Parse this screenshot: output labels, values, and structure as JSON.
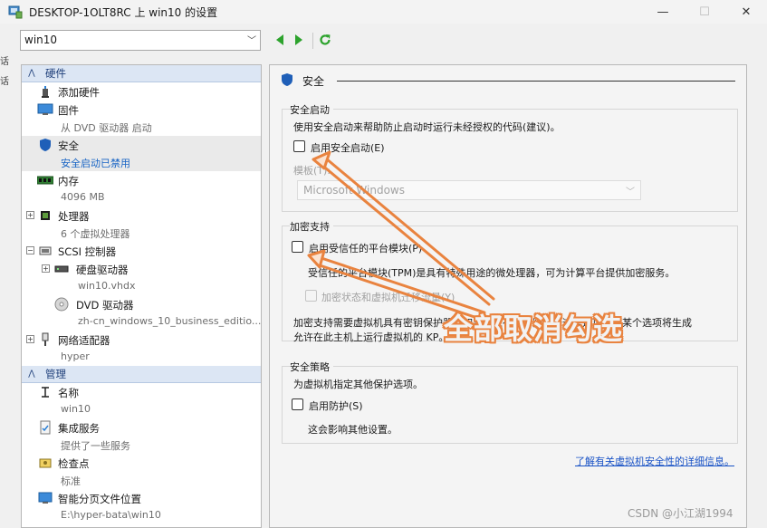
{
  "window": {
    "title": "DESKTOP-1OLT8RC 上 win10 的设置",
    "minimize": "—",
    "maximize": "☐",
    "close": "✕"
  },
  "toolbar": {
    "vm_name": "win10"
  },
  "edge_glyphs": [
    "话",
    "话"
  ],
  "nav": {
    "hardware_header": "硬件",
    "management_header": "管理",
    "hardware_items": [
      {
        "name": "添加硬件",
        "sub": "",
        "icon": "add-hardware-icon"
      },
      {
        "name": "固件",
        "sub": "从 DVD 驱动器 启动",
        "icon": "firmware-icon"
      },
      {
        "name": "安全",
        "sub": "安全启动已禁用",
        "icon": "shield-icon"
      },
      {
        "name": "内存",
        "sub": "4096 MB",
        "icon": "memory-icon"
      },
      {
        "name": "处理器",
        "sub": "6 个虚拟处理器",
        "icon": "processor-icon"
      },
      {
        "name": "SCSI 控制器",
        "sub": "",
        "icon": "scsi-controller-icon"
      },
      {
        "name": "硬盘驱动器",
        "sub": "win10.vhdx",
        "icon": "hard-drive-icon"
      },
      {
        "name": "DVD 驱动器",
        "sub": "zh-cn_windows_10_business_editio...",
        "icon": "dvd-drive-icon"
      },
      {
        "name": "网络适配器",
        "sub": "hyper",
        "icon": "network-adapter-icon"
      }
    ],
    "management_items": [
      {
        "name": "名称",
        "sub": "win10",
        "icon": "name-icon"
      },
      {
        "name": "集成服务",
        "sub": "提供了一些服务",
        "icon": "integration-services-icon"
      },
      {
        "name": "检查点",
        "sub": "标准",
        "icon": "checkpoint-icon"
      },
      {
        "name": "智能分页文件位置",
        "sub": "E:\\hyper-bata\\win10",
        "icon": "paging-file-icon"
      }
    ]
  },
  "security": {
    "section_title": "安全",
    "secure_boot": {
      "group_label": "安全启动",
      "description": "使用安全启动来帮助防止启动时运行未经授权的代码(建议)。",
      "checkbox_label": "启用安全启动(E)",
      "template_label": "模板(T):",
      "template_value": "Microsoft Windows"
    },
    "encryption": {
      "group_label": "加密支持",
      "tpm_checkbox_label": "启用受信任的平台模块(P)",
      "tpm_description": "受信任的平台模块(TPM)是具有特殊用途的微处理器，可为计算平台提供加密服务。",
      "encrypt_checkbox_label": "加密状态和虚拟机迁移流量(Y)",
      "note_line1": "加密支持需要虚拟机具有密钥保护器。如果尚未存在，则选择这些选项中的某个选项将生成",
      "note_line2": "允许在此主机上运行虚拟机的 KP。"
    },
    "policy": {
      "group_label": "安全策略",
      "description": "为虚拟机指定其他保护选项。",
      "checkbox_label": "启用防护(S)",
      "note": "这会影响其他设置。"
    },
    "learn_more": "了解有关虚拟机安全性的详细信息。"
  },
  "annotation": {
    "text": "全部取消勾选",
    "color": "#e9833f"
  },
  "watermark": "CSDN @小江湖1994"
}
